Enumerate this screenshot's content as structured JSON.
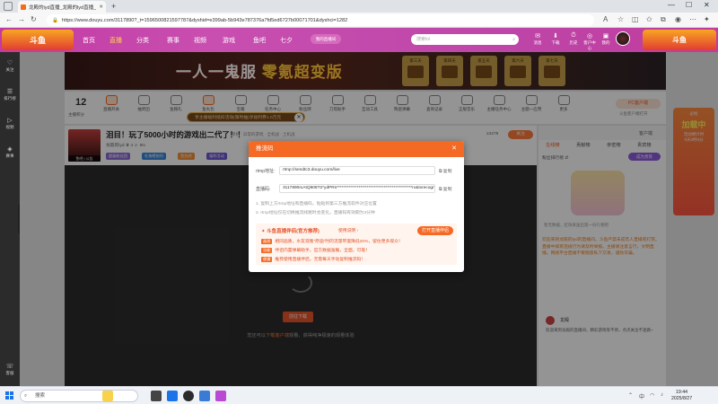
{
  "browser": {
    "tab_title": "龙殿的lyd直播_龙殿的lyd直播_斗",
    "url": "https://www.douyu.com/3117890?_t=1596500821597787&dyshid=e399ab-5b943e787376a7fd5ed6727b00071701&dyshci=1282",
    "new_tab_symbol": "+"
  },
  "site_header": {
    "logo_left": "斗鱼",
    "menu": [
      "首页",
      "直播",
      "分类",
      "赛事",
      "视频",
      "游戏",
      "鱼吧",
      "七夕"
    ],
    "pill_text": "我的直播间",
    "search_placeholder": "搜索lol",
    "icons": [
      {
        "icon": "message-icon",
        "label": "消息"
      },
      {
        "icon": "fish-icon",
        "label": "下载"
      },
      {
        "icon": "history-icon",
        "label": "历史"
      },
      {
        "icon": "center-icon",
        "label": "客户中心"
      },
      {
        "icon": "live-icon",
        "label": "我的"
      }
    ],
    "logo_right": "斗鱼"
  },
  "sidebar": {
    "items": [
      {
        "icon": "heart-icon",
        "label": "关注"
      },
      {
        "icon": "list-icon",
        "label": "排行榜"
      },
      {
        "icon": "video-icon",
        "label": "视频"
      },
      {
        "icon": "gift-icon",
        "label": "赛事"
      }
    ],
    "bottom": {
      "icon": "back-icon",
      "label": "客服"
    }
  },
  "banner": {
    "title_part1": "一人一鬼服",
    "title_part2": "零氪超变版",
    "prizes": [
      "第三天",
      "第四天",
      "第五天",
      "第六天",
      "第七天"
    ]
  },
  "toolbar": {
    "rank_number": "12",
    "rank_label": "主播积分",
    "tools": [
      "直播开关",
      "抽奖团",
      "鱼粮礼",
      "鱼丸包",
      "宝箱",
      "任务中心",
      "粉丝牌",
      "刀塔助手",
      "互动工具",
      "陶瓷弹幕",
      "查询记录",
      "正版音乐",
      "主播任务中心",
      "主题一应用",
      "更多"
    ],
    "tip": "享主播福利抵扣活动(限时抽)享福利券1.0万元",
    "pc_pill": "PC客户端",
    "pc_sub": "斗鱼客户端打开"
  },
  "streamer": {
    "title": "泪目！玩了5000小时的游戏出二代了！！",
    "categories": "单机 · 异常的游戏 · 全机战 · 土机战",
    "meta": "龙殿的lyd   ♛ 4   ♬ 6N",
    "avatar_tag": "鱼吧 | 公告",
    "badges": [
      {
        "text": "超级粉丝团",
        "color": "#8b6bd6"
      },
      {
        "text": "礼物榜前列",
        "color": "#3a86d9"
      },
      {
        "text": "鱼丸吧",
        "color": "#f2913a"
      },
      {
        "text": "福利活动",
        "color": "#6d56d1"
      }
    ],
    "follow_count": "24279",
    "follow_label": "关注"
  },
  "player": {
    "download_btn": "前往下载",
    "hint_prefix": "您还可以",
    "hint_link": "下载客户端",
    "hint_suffix": "观看，获得纯净极速的观看体验"
  },
  "right_panel": {
    "top_text": "客户端",
    "tabs": [
      "在线榜",
      "贡献榜",
      "亲密榜",
      "贵宾榜"
    ],
    "rank_switch": "粉丝排行榜 ⇵",
    "rank_btn": "成为贵宾",
    "note": "暂无数据，赶快来送出第一份礼物吧",
    "message": "欢迎来到龙殿的lyd的直播间，斗鱼严禁未成年人直播或打赏。直播中如有违规行为请及时举报。主播请注意言行，文明直播。网络平台直播不要随意私下交易，谨防诈骗。",
    "user_name": "龙殿",
    "user_text": "欢迎来到龙殿的直播间，精彩游戏等不停，点点关注不迷路~"
  },
  "far_right": {
    "gift_line1": "必抢",
    "gift_big": "加载中",
    "gift_line2": "活动倒计时",
    "gift_line3": "0天0时0分"
  },
  "modal": {
    "title": "推流码",
    "rtmp_label": "rtmp地址:",
    "rtmp_value": "rtmp://sendtc3.douyu.com/live",
    "key_label": "直播码:",
    "key_value": "3117890rxAtQ908T2*ydPRs*********************************************rv&txrecognition=",
    "copy_label": "复制",
    "note1": "1. 复制上方rtmp地址和直播码，粘贴到第三方推流软件对应位置",
    "note2": "2. rtmp地址仅在切换推流线路时会变化，直播码有效期为3分钟",
    "promo_title": "斗鱼直播伴侣(官方推荐)",
    "promo_link": "使用说明 ›",
    "promo_btn": "打开直播伴侣",
    "promo_lines": [
      {
        "tag": "画质",
        "text": "相同画质，水友观看“原画”时的流量带宽降低20%，留住更多观众！"
      },
      {
        "tag": "功能",
        "text": "伴侣内置弹幕助手，官方数据准确，全面，可靠！"
      },
      {
        "tag": "便捷",
        "text": "推荐使用直播伴侣，无需每天手动复制推流码！"
      }
    ]
  },
  "taskbar": {
    "search_placeholder": "搜索",
    "time": "19:44",
    "date": "2025/8/27",
    "tray_lang": "中"
  }
}
